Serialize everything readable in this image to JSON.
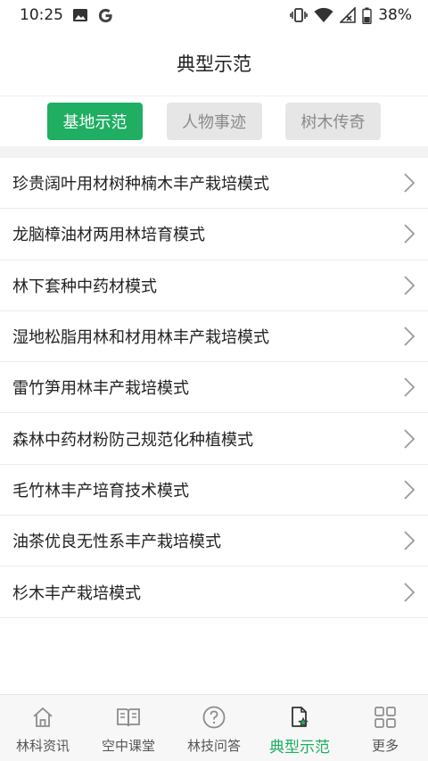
{
  "status_bar": {
    "time": "10:25",
    "battery": "38%",
    "icons": [
      "image-icon",
      "google-icon",
      "vibrate-icon",
      "wifi-icon",
      "signal-icon",
      "battery-icon"
    ]
  },
  "header": {
    "title": "典型示范"
  },
  "tabs": [
    {
      "label": "基地示范",
      "active": true
    },
    {
      "label": "人物事迹",
      "active": false
    },
    {
      "label": "树木传奇",
      "active": false
    }
  ],
  "list": [
    {
      "title": "珍贵阔叶用材树种楠木丰产栽培模式"
    },
    {
      "title": "龙脑樟油材两用林培育模式"
    },
    {
      "title": "林下套种中药材模式"
    },
    {
      "title": "湿地松脂用林和材用林丰产栽培模式"
    },
    {
      "title": "雷竹笋用林丰产栽培模式"
    },
    {
      "title": "森林中药材粉防己规范化种植模式"
    },
    {
      "title": "毛竹林丰产培育技术模式"
    },
    {
      "title": "油茶优良无性系丰产栽培模式"
    },
    {
      "title": "杉木丰产栽培模式"
    }
  ],
  "bottom_nav": [
    {
      "label": "林科资讯",
      "icon": "home-icon"
    },
    {
      "label": "空中课堂",
      "icon": "book-icon"
    },
    {
      "label": "林技问答",
      "icon": "question-icon"
    },
    {
      "label": "典型示范",
      "icon": "document-star-icon",
      "active": true
    },
    {
      "label": "更多",
      "icon": "grid-icon"
    }
  ],
  "colors": {
    "accent": "#1fae62",
    "tab_inactive_bg": "#e6e6e6",
    "tab_inactive_text": "#8a8a8a"
  }
}
